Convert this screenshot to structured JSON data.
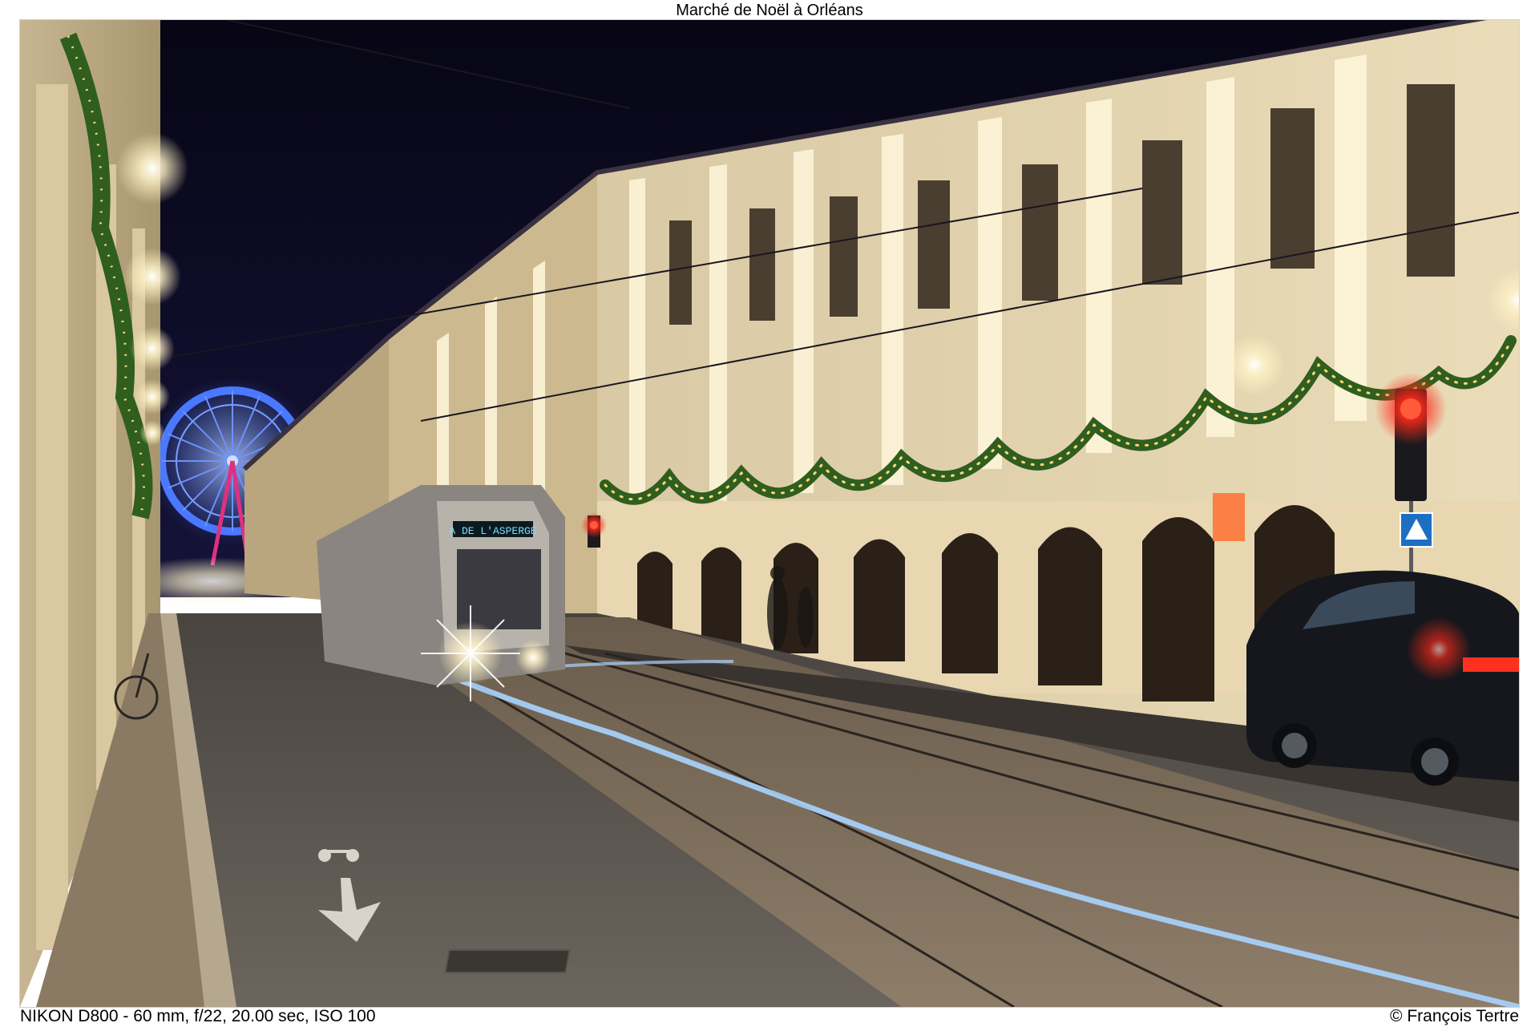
{
  "caption": {
    "title": "Marché de Noël à Orléans",
    "exif": "NIKON D800 - 60 mm, f/22, 20.00 sec, ISO 100",
    "credit": "© François Tertre"
  },
  "scene": {
    "tram_destination": "A DE L'ASPERGE",
    "icons": [
      "ferris-wheel-icon",
      "tram-icon",
      "traffic-light-icon",
      "pedestrian-crossing-sign-icon",
      "bicycle-lane-icon",
      "down-arrow-road-marking-icon",
      "car-icon"
    ],
    "colors": {
      "night_sky": "#0b0a22",
      "facade_light": "#efe0bf",
      "ferris_wheel": "#4a78ff",
      "garland": "#2f5e1e",
      "light_trail": "#a9d4ff",
      "traffic_red": "#ff2a1a"
    }
  }
}
